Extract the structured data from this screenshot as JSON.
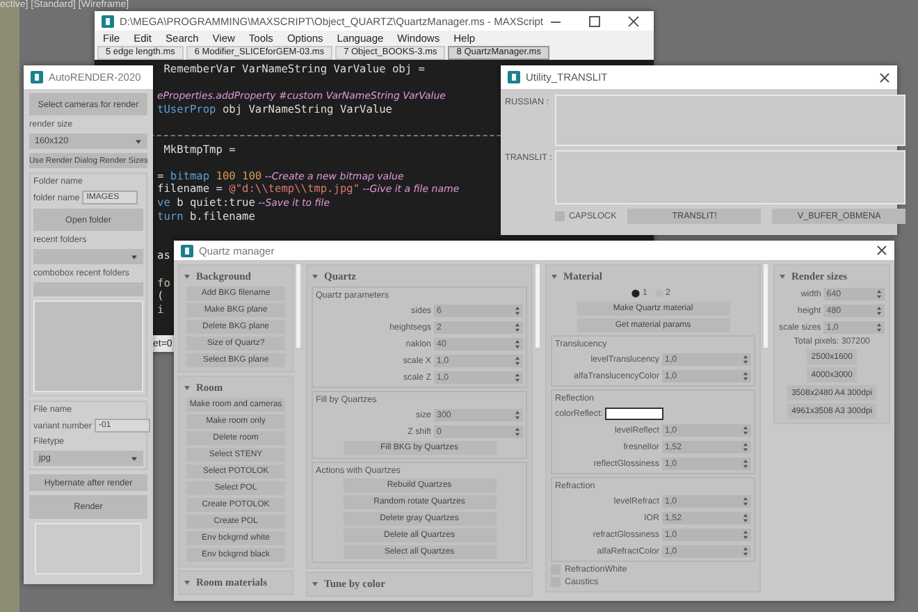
{
  "viewport_label": "ective] [Standard] [Wireframe]",
  "maxscript": {
    "title": "D:\\MEGA\\PROGRAMMING\\MAXSCRIPT\\Object_QUARTZ\\QuartzManager.ms - MAXScript",
    "menu": [
      "File",
      "Edit",
      "Search",
      "View",
      "Tools",
      "Options",
      "Language",
      "Windows",
      "Help"
    ],
    "tabs": [
      {
        "label": "5 edge length.ms",
        "selected": false
      },
      {
        "label": "6 Modifier_SLICEforGEM-03.ms",
        "selected": false
      },
      {
        "label": "7 Object_BOOKS-3.ms",
        "selected": false
      },
      {
        "label": "8 QuartzManager.ms",
        "selected": true
      }
    ],
    "code_lines": [
      {
        "kind": "code",
        "tokens": [
          {
            "kind": "plain",
            "text": " RememberVar VarNameString VarValue obj ="
          }
        ]
      },
      {
        "kind": "blank"
      },
      {
        "kind": "code",
        "tokens": [
          {
            "kind": "comment",
            "text": "eProperties.addProperty #custom VarNameString VarValue"
          }
        ]
      },
      {
        "kind": "code",
        "tokens": [
          {
            "kind": "keyword",
            "text": "tUserProp"
          },
          {
            "kind": "plain",
            "text": " obj VarNameString VarValue"
          }
        ]
      },
      {
        "kind": "blank"
      },
      {
        "kind": "divider"
      },
      {
        "kind": "code",
        "tokens": [
          {
            "kind": "plain",
            "text": " MkBtmpTmp ="
          }
        ]
      },
      {
        "kind": "blank"
      },
      {
        "kind": "code",
        "tokens": [
          {
            "kind": "plain",
            "text": "= "
          },
          {
            "kind": "keyword",
            "text": "bitmap"
          },
          {
            "kind": "number",
            "text": " 100 100"
          },
          {
            "kind": "comment",
            "text": " --Create a new bitmap value"
          }
        ]
      },
      {
        "kind": "code",
        "tokens": [
          {
            "kind": "plain",
            "text": "filename = "
          },
          {
            "kind": "string",
            "text": "@\"d:\\\\temp\\\\tmp.jpg\""
          },
          {
            "kind": "comment",
            "text": " --Give it a file name"
          }
        ]
      },
      {
        "kind": "code",
        "tokens": [
          {
            "kind": "keyword",
            "text": "ve"
          },
          {
            "kind": "plain",
            "text": " b quiet:true"
          },
          {
            "kind": "comment",
            "text": " --Save it to file"
          }
        ]
      },
      {
        "kind": "code",
        "tokens": [
          {
            "kind": "keyword",
            "text": "turn"
          },
          {
            "kind": "plain",
            "text": " b.filename"
          }
        ]
      },
      {
        "kind": "blank"
      },
      {
        "kind": "blank"
      },
      {
        "kind": "code",
        "tokens": [
          {
            "kind": "plain",
            "text": "as"
          }
        ]
      },
      {
        "kind": "blank"
      },
      {
        "kind": "code",
        "tokens": [
          {
            "kind": "green",
            "text": "fo"
          }
        ]
      },
      {
        "kind": "code",
        "tokens": [
          {
            "kind": "plain",
            "text": "("
          }
        ]
      },
      {
        "kind": "code",
        "tokens": [
          {
            "kind": "green",
            "text": "i"
          }
        ]
      }
    ],
    "status": "et=0"
  },
  "autorender": {
    "title": "AutoRENDER-2020",
    "select_cameras_button": "Select cameras for render",
    "render_size": {
      "label": "render size",
      "value": "160x120"
    },
    "use_render_dialog_button": "Use Render Dialog Render Sizes",
    "folder_group": {
      "title": "Folder name",
      "folder_name": {
        "label": "folder name",
        "value": "IMAGES"
      },
      "open_folder_button": "Open folder",
      "recent_folders_label": "recent folders",
      "combobox_label": "combobox recent folders"
    },
    "file_group": {
      "title": "File name",
      "variant_number": {
        "label": "variant number",
        "value": "-01"
      },
      "filetype": {
        "label": "Filetype",
        "value": "jpg"
      }
    },
    "hybernate_button": "Hybernate after render",
    "render_button": "Render"
  },
  "translit": {
    "title": "Utility_TRANSLIT",
    "russian_label": "RUSSIAN :",
    "translit_label": "TRANSLIT :",
    "capslock": {
      "label": "CAPSLOCK",
      "checked": false
    },
    "buttons": [
      "TRANSLIT!",
      "V_BUFER_OBMENA"
    ]
  },
  "quartz_manager": {
    "title": "Quartz manager",
    "columns": [
      {
        "rollouts": [
          {
            "title": "Background",
            "items": [
              {
                "kind": "button",
                "label": "Add BKG filename"
              },
              {
                "kind": "button",
                "label": "Make BKG plane"
              },
              {
                "kind": "button",
                "label": "Delete BKG plane"
              },
              {
                "kind": "button",
                "label": "Size of Quartz?"
              },
              {
                "kind": "button",
                "label": "Select BKG plane"
              }
            ]
          },
          {
            "title": "Room",
            "items": [
              {
                "kind": "button",
                "label": "Make room and cameras"
              },
              {
                "kind": "button",
                "label": "Make room only"
              },
              {
                "kind": "button",
                "label": "Delete room"
              },
              {
                "kind": "button",
                "label": "Select STENY"
              },
              {
                "kind": "button",
                "label": "Select POTOLOK"
              },
              {
                "kind": "button",
                "label": "Select POL"
              },
              {
                "kind": "button",
                "label": "Create POTOLOK"
              },
              {
                "kind": "button",
                "label": "Create POL"
              },
              {
                "kind": "button",
                "label": "Env bckgrnd white"
              },
              {
                "kind": "button",
                "label": "Env bckgrnd black"
              }
            ]
          },
          {
            "title": "Room materials"
          }
        ]
      },
      {
        "rollouts": [
          {
            "title": "Quartz",
            "items": [
              {
                "kind": "group",
                "title": "Quartz parameters",
                "items": [
                  {
                    "kind": "spinner",
                    "label": "sides",
                    "value": "6"
                  },
                  {
                    "kind": "spinner",
                    "label": "heightsegs",
                    "value": "2"
                  },
                  {
                    "kind": "spinner",
                    "label": "naklon",
                    "value": "40"
                  },
                  {
                    "kind": "spinner",
                    "label": "scale X",
                    "value": "1,0"
                  },
                  {
                    "kind": "spinner",
                    "label": "scale Z",
                    "value": "1,0"
                  }
                ]
              },
              {
                "kind": "group",
                "title": "Fill by Quartzes",
                "items": [
                  {
                    "kind": "spinner",
                    "label": "size",
                    "value": "300"
                  },
                  {
                    "kind": "spinner",
                    "label": "Z shift",
                    "value": "0"
                  },
                  {
                    "kind": "button",
                    "label": "Fill BKG by Quartzes"
                  }
                ]
              },
              {
                "kind": "group",
                "title": "Actions with Quartzes",
                "items": [
                  {
                    "kind": "button",
                    "label": "Rebuild Quartzes"
                  },
                  {
                    "kind": "button",
                    "label": "Random rotate Quartzes"
                  },
                  {
                    "kind": "button",
                    "label": "Delete gray Quartzes"
                  },
                  {
                    "kind": "button",
                    "label": "Delete all Quartzes"
                  },
                  {
                    "kind": "button",
                    "label": "Select all Quartzes"
                  }
                ]
              }
            ]
          },
          {
            "title": "Tune by color"
          }
        ]
      },
      {
        "rollouts": [
          {
            "title": "Material",
            "items": [
              {
                "kind": "radio",
                "options": [
                  {
                    "label": "1",
                    "selected": true
                  },
                  {
                    "label": "2",
                    "selected": false
                  }
                ]
              },
              {
                "kind": "button",
                "label": "Make Quartz material"
              },
              {
                "kind": "button",
                "label": "Get material params"
              },
              {
                "kind": "group",
                "title": "Translucency",
                "items": [
                  {
                    "kind": "spinner",
                    "label": "levelTranslucency",
                    "value": "1,0"
                  },
                  {
                    "kind": "spinner",
                    "label": "alfaTranslucencyColor",
                    "value": "1,0"
                  }
                ]
              },
              {
                "kind": "group",
                "title": "Reflection",
                "items": [
                  {
                    "kind": "color",
                    "label": "colorReflect:"
                  },
                  {
                    "kind": "spinner",
                    "label": "levelReflect",
                    "value": "1,0"
                  },
                  {
                    "kind": "spinner",
                    "label": "fresnelIor",
                    "value": "1,52"
                  },
                  {
                    "kind": "spinner",
                    "label": "reflectGlossiness",
                    "value": "1,0"
                  }
                ]
              },
              {
                "kind": "group",
                "title": "Refraction",
                "items": [
                  {
                    "kind": "spinner",
                    "label": "levelRefract",
                    "value": "1,0"
                  },
                  {
                    "kind": "spinner",
                    "label": "IOR",
                    "value": "1,52"
                  },
                  {
                    "kind": "spinner",
                    "label": "refractGlossiness",
                    "value": "1,0"
                  },
                  {
                    "kind": "spinner",
                    "label": "alfaRefractColor",
                    "value": "1,0"
                  }
                ]
              },
              {
                "kind": "checkbox",
                "label": "RefractionWhite",
                "checked": false
              },
              {
                "kind": "checkbox",
                "label": "Caustics",
                "checked": false
              }
            ]
          }
        ]
      },
      {
        "rollouts": [
          {
            "title": "Render sizes",
            "items": [
              {
                "kind": "spinner",
                "label": "width",
                "value": "640"
              },
              {
                "kind": "spinner",
                "label": "height",
                "value": "480"
              },
              {
                "kind": "spinner",
                "label": "scale sizes",
                "value": "1,0"
              },
              {
                "kind": "text",
                "text": "Total pixels: 307200"
              },
              {
                "kind": "button",
                "label": "2500x1600"
              },
              {
                "kind": "button",
                "label": "4000x3000"
              },
              {
                "kind": "button",
                "label": "3508x2480 A4 300dpi"
              },
              {
                "kind": "button",
                "label": "4961x3508 A3 300dpi"
              }
            ]
          }
        ]
      }
    ]
  }
}
